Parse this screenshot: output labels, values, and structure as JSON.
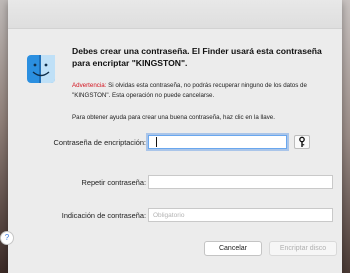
{
  "dialog": {
    "title": "Debes crear una contraseña. El Finder usará esta contraseña para encriptar \"KINGSTON\".",
    "warning_label": "Advertencia:",
    "warning_text": " Si olvidas esta contraseña, no podrás recuperar ninguno de los datos de \"KINGSTON\". Esta operación no puede cancelarse.",
    "help_text": "Para obtener ayuda para crear una buena contraseña, haz clic en la llave.",
    "fields": {
      "password_label": "Contraseña de encriptación:",
      "password_value": "",
      "repeat_label": "Repetir contraseña:",
      "repeat_value": "",
      "hint_label": "Indicación de contraseña:",
      "hint_placeholder": "Obligatorio"
    },
    "buttons": {
      "help": "?",
      "cancel": "Cancelar",
      "encrypt": "Encriptar disco"
    },
    "icons": {
      "app": "finder-icon",
      "key": "key-icon"
    },
    "colors": {
      "warning": "#d3121e",
      "focus_ring": "#6aa7ee",
      "help_glyph": "#3b7de0"
    }
  }
}
